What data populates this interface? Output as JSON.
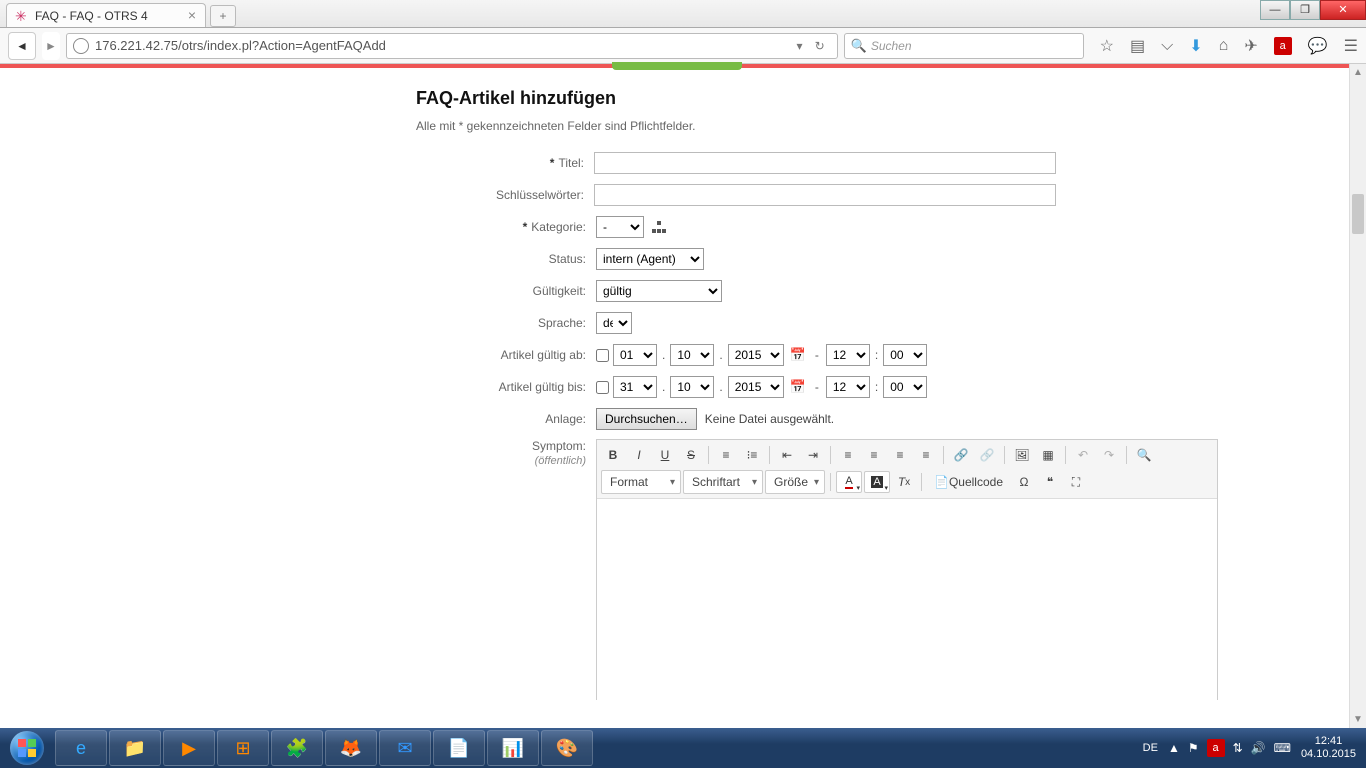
{
  "browser": {
    "tab_title": "FAQ - FAQ - OTRS 4",
    "url": "176.221.42.75/otrs/index.pl?Action=AgentFAQAdd",
    "search_placeholder": "Suchen"
  },
  "page": {
    "heading": "FAQ-Artikel hinzufügen",
    "subtitle": "Alle mit * gekennzeichneten Felder sind Pflichtfelder."
  },
  "labels": {
    "title": "Titel:",
    "keywords": "Schlüsselwörter:",
    "category": "Kategorie:",
    "status": "Status:",
    "validity": "Gültigkeit:",
    "language": "Sprache:",
    "valid_from": "Artikel gültig ab:",
    "valid_to": "Artikel gültig bis:",
    "attachment": "Anlage:",
    "symptom": "Symptom:",
    "symptom_note": "(öffentlich)"
  },
  "values": {
    "title": "",
    "keywords": "",
    "category": "-",
    "status": "intern (Agent)",
    "validity": "gültig",
    "language": "de",
    "from_day": "01",
    "from_month": "10",
    "from_year": "2015",
    "from_hr": "12",
    "from_min": "00",
    "to_day": "31",
    "to_month": "10",
    "to_year": "2015",
    "to_hr": "12",
    "to_min": "00",
    "file_button": "Durchsuchen…",
    "file_msg": "Keine Datei ausgewählt."
  },
  "editor": {
    "format": "Format",
    "font": "Schriftart",
    "size": "Größe",
    "source": "Quellcode"
  },
  "taskbar": {
    "lang": "DE",
    "time": "12:41",
    "date": "04.10.2015"
  }
}
